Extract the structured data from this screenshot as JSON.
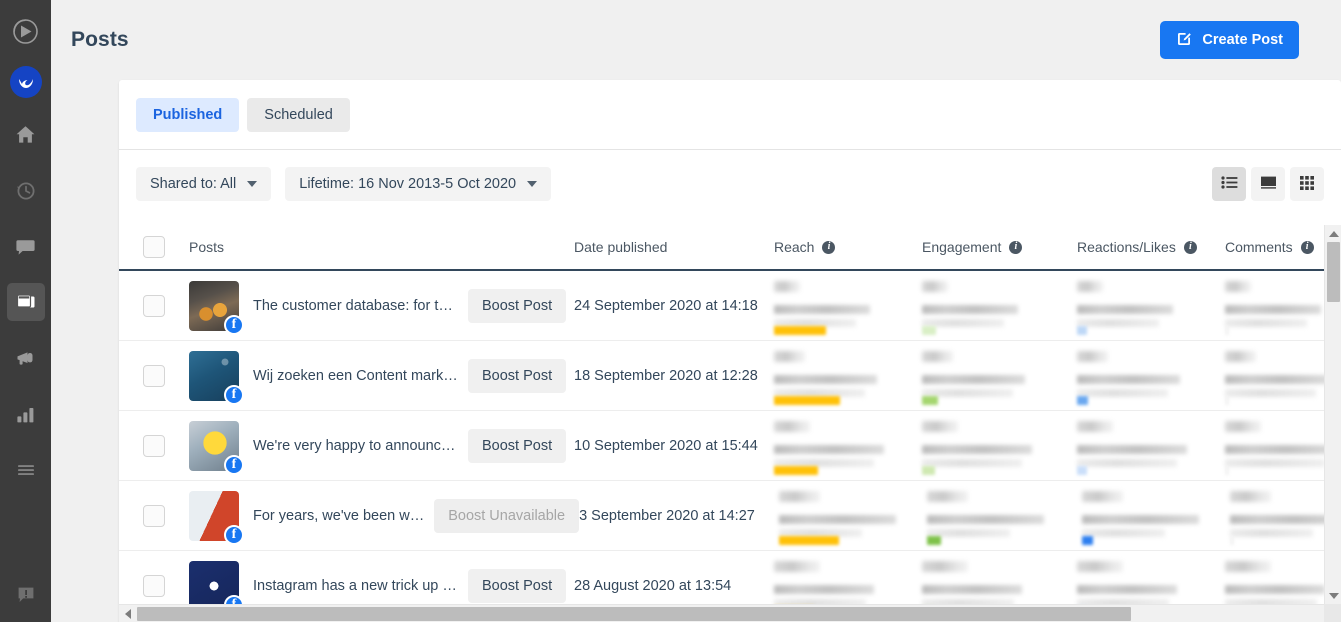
{
  "sidebar": {
    "toggle_icon": "collapse-nav-icon",
    "avatar_icon": "workspace-avatar",
    "items": [
      {
        "icon": "home-icon",
        "name": "home",
        "active": false
      },
      {
        "icon": "clock-icon",
        "name": "activity",
        "active": false
      },
      {
        "icon": "chat-icon",
        "name": "messages",
        "active": false
      },
      {
        "icon": "posts-icon",
        "name": "posts",
        "active": true
      },
      {
        "icon": "megaphone-icon",
        "name": "promote",
        "active": false
      },
      {
        "icon": "bar-chart-icon",
        "name": "reports",
        "active": false
      },
      {
        "icon": "menu-icon",
        "name": "more",
        "active": false
      }
    ],
    "bottom_icon": "feedback-icon"
  },
  "header": {
    "title": "Posts",
    "create_button": {
      "label": "Create Post",
      "icon": "compose-icon",
      "color": "#1877f2"
    }
  },
  "tabs": [
    {
      "label": "Published",
      "selected": true
    },
    {
      "label": "Scheduled",
      "selected": false
    }
  ],
  "filters": [
    {
      "label": "Shared to: All",
      "icon": "chevron-down-icon"
    },
    {
      "label": "Lifetime: 16 Nov 2013-5 Oct 2020",
      "icon": "chevron-down-icon"
    }
  ],
  "view_toggle": [
    {
      "icon": "list-view-icon",
      "active": true
    },
    {
      "icon": "card-view-icon",
      "active": false
    },
    {
      "icon": "grid-view-icon",
      "active": false
    }
  ],
  "table": {
    "columns": [
      {
        "label": "",
        "info": false
      },
      {
        "label": "Posts",
        "info": false
      },
      {
        "label": "Date published",
        "info": false
      },
      {
        "label": "Reach",
        "info": true
      },
      {
        "label": "Engagement",
        "info": true
      },
      {
        "label": "Reactions/Likes",
        "info": true
      },
      {
        "label": "Comments",
        "info": true
      }
    ],
    "rows": [
      {
        "title": "The customer database: for te…",
        "boost_label": "Boost Post",
        "boost_enabled": true,
        "date": "24 September 2020 at 14:18",
        "network": "facebook",
        "thumb": "beer-cheers-photo",
        "metrics": {
          "reach_bar_color": "#ffc107",
          "reach_bar_width": 52,
          "engagement_bar_color": "#d9efc6",
          "engagement_bar_width": 14,
          "reactions_bar_color": "#bed8f7",
          "reactions_bar_width": 10,
          "comments_bar_color": "#f2f2f2",
          "comments_bar_width": 4
        }
      },
      {
        "title": "Wij zoeken een Content market…",
        "boost_label": "Boost Post",
        "boost_enabled": true,
        "date": "18 September 2020 at 12:28",
        "network": "facebook",
        "thumb": "blue-gradient-graphic",
        "metrics": {
          "reach_bar_color": "#ffc107",
          "reach_bar_width": 66,
          "engagement_bar_color": "#a5d66f",
          "engagement_bar_width": 16,
          "reactions_bar_color": "#6aa8f0",
          "reactions_bar_width": 11,
          "comments_bar_color": "#f2f2f2",
          "comments_bar_width": 4
        }
      },
      {
        "title": "We're very happy to announce t…",
        "boost_label": "Boost Post",
        "boost_enabled": true,
        "date": "10 September 2020 at 15:44",
        "network": "facebook",
        "thumb": "emoji-selfie-photo",
        "metrics": {
          "reach_bar_color": "#ffc107",
          "reach_bar_width": 44,
          "engagement_bar_color": "#cfe9b2",
          "engagement_bar_width": 13,
          "reactions_bar_color": "#cadffa",
          "reactions_bar_width": 10,
          "comments_bar_color": "#f2f2f2",
          "comments_bar_width": 4
        }
      },
      {
        "title": "For years, we've been w…",
        "boost_label": "Boost Unavailable",
        "boost_enabled": false,
        "date": "3 September 2020 at 14:27",
        "network": "facebook",
        "thumb": "phone-orange-graphic",
        "metrics": {
          "reach_bar_color": "#ffc107",
          "reach_bar_width": 60,
          "engagement_bar_color": "#7fc24a",
          "engagement_bar_width": 14,
          "reactions_bar_color": "#2d7ff0",
          "reactions_bar_width": 11,
          "comments_bar_color": "#f2f2f2",
          "comments_bar_width": 4
        }
      },
      {
        "title": "Instagram has a new trick up it…",
        "boost_label": "Boost Post",
        "boost_enabled": true,
        "date": "28 August 2020 at 13:54",
        "network": "facebook",
        "thumb": "dark-blue-logo-graphic",
        "metrics": {
          "reach_bar_color": "#ffc107",
          "reach_bar_width": 40,
          "engagement_bar_color": "#cfe9b2",
          "engagement_bar_width": 12,
          "reactions_bar_color": "#cadffa",
          "reactions_bar_width": 9,
          "comments_bar_color": "#f2f2f2",
          "comments_bar_width": 4
        }
      }
    ]
  },
  "scrollbars": {
    "vertical_up_icon": "scroll-up-arrow",
    "vertical_down_icon": "scroll-down-arrow",
    "horizontal_left_icon": "scroll-left-arrow",
    "horizontal_right_icon": "scroll-right-arrow"
  }
}
